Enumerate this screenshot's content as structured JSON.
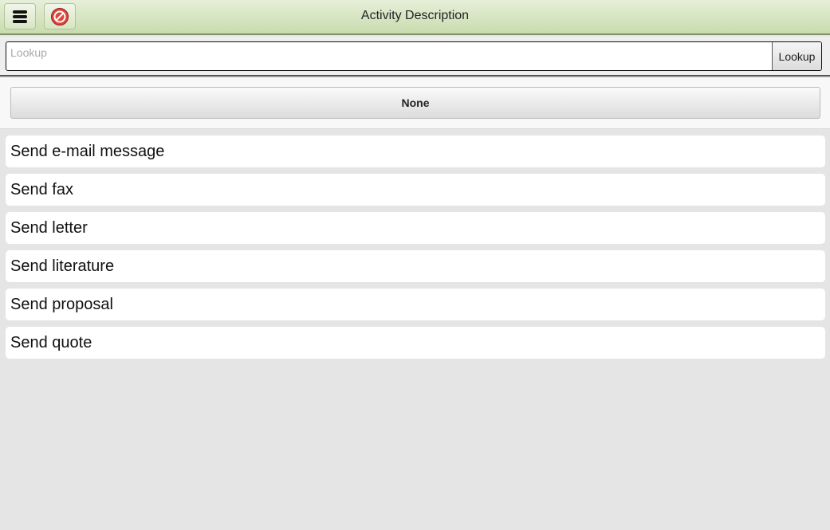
{
  "header": {
    "title": "Activity Description",
    "menu_icon": "menu-icon",
    "cancel_icon": "cancel-icon"
  },
  "lookup": {
    "placeholder": "Lookup",
    "value": "",
    "button_label": "Lookup"
  },
  "none_button": {
    "label": "None"
  },
  "list": {
    "items": [
      {
        "label": "Send e-mail message"
      },
      {
        "label": "Send fax"
      },
      {
        "label": "Send letter"
      },
      {
        "label": "Send literature"
      },
      {
        "label": "Send proposal"
      },
      {
        "label": "Send quote"
      }
    ]
  },
  "colors": {
    "header_top": "#e6efd9",
    "header_bottom": "#c9dcae",
    "background": "#e5e5e5",
    "cancel_red": "#e0463c"
  }
}
